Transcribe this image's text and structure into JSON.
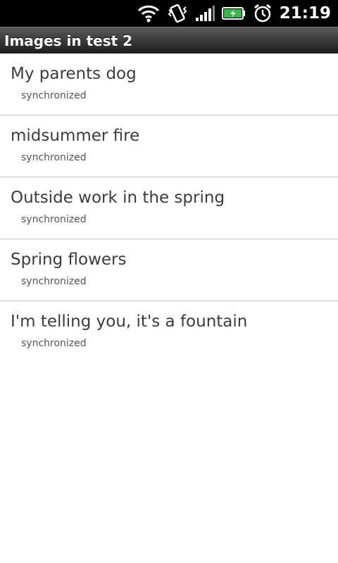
{
  "status_bar": {
    "time": "21:19",
    "icons": [
      "wifi-icon",
      "vibrate-icon",
      "signal-icon",
      "battery-charging-icon",
      "alarm-icon"
    ],
    "battery_color": "#39b54a"
  },
  "header": {
    "title": "Images in test 2"
  },
  "images": [
    {
      "title": "My parents dog",
      "status": "synchronized"
    },
    {
      "title": "midsummer fire",
      "status": "synchronized"
    },
    {
      "title": "Outside work in the spring",
      "status": "synchronized"
    },
    {
      "title": "Spring flowers",
      "status": "synchronized"
    },
    {
      "title": "I'm telling you, it's a fountain",
      "status": "synchronized"
    }
  ]
}
